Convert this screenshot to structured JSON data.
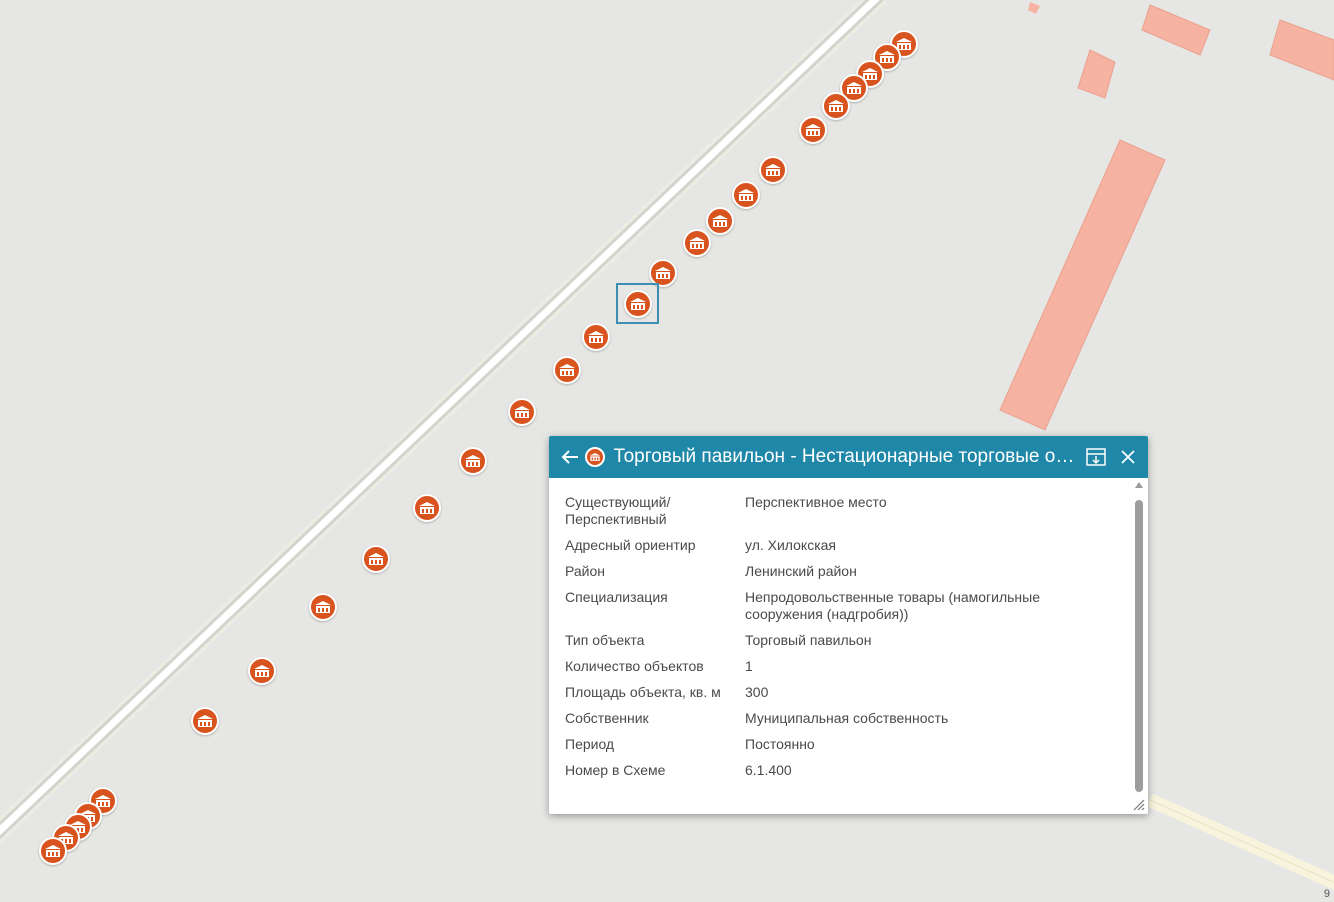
{
  "popup": {
    "title": "Торговый павильон - Нестационарные торговые объекты",
    "back_icon": "arrow-left-icon",
    "dock_icon": "dock-icon",
    "close_icon": "close-icon",
    "attributes": [
      {
        "key": "Существующий/ Перспективный",
        "value": "Перспективное место"
      },
      {
        "key": "Адресный ориентир",
        "value": "ул. Хилокская"
      },
      {
        "key": "Район",
        "value": "Ленинский район"
      },
      {
        "key": "Специализация",
        "value": "Непродовольственные товары (намогильные сооружения (надгробия))"
      },
      {
        "key": "Тип объекта",
        "value": "Торговый павильон"
      },
      {
        "key": "Количество объектов",
        "value": "1"
      },
      {
        "key": "Площадь объекта, кв. м",
        "value": "300"
      },
      {
        "key": "Собственник",
        "value": "Муниципальная собственность"
      },
      {
        "key": "Период",
        "value": "Постоянно"
      },
      {
        "key": "Номер в Схеме",
        "value": "6.1.400"
      }
    ]
  },
  "map": {
    "corner_label": "9",
    "marker_icon": "kiosk-icon",
    "colors": {
      "marker": "#d9531e",
      "header": "#1f87a8",
      "selection": "#3b8fb3",
      "building": "#f6b3a2",
      "background": "#e6e6e4"
    }
  }
}
